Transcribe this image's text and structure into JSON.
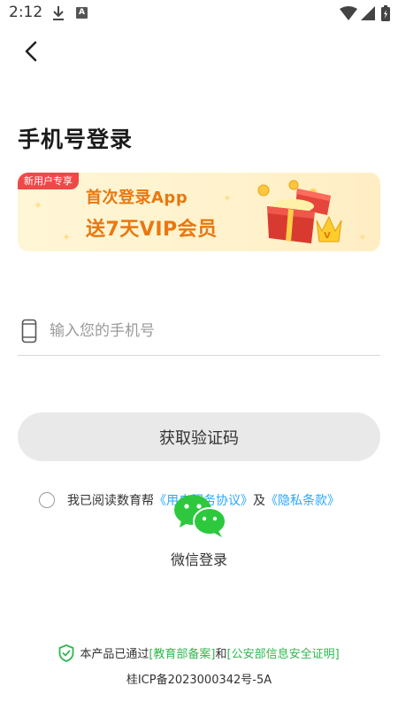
{
  "status_bar": {
    "time": "2:12",
    "icon_a": "A"
  },
  "title": "手机号登录",
  "promo": {
    "badge": "新用户专享",
    "line1": "首次登录App",
    "line2": "送7天VIP会员"
  },
  "phone": {
    "placeholder": "输入您的手机号",
    "value": ""
  },
  "get_code_button": "获取验证码",
  "agreement": {
    "prefix": "我已阅读数育帮",
    "service_link": "《用户服务协议》",
    "conjunction": "及",
    "privacy_link": "《隐私条款》",
    "checked": false
  },
  "wechat_login": "微信登录",
  "footer": {
    "prefix": "本产品已通过",
    "link1": "[教育部备案]",
    "mid": "和",
    "link2": "[公安部信息安全证明]",
    "icp": "桂ICP备2023000342号-5A"
  },
  "colors": {
    "accent_blue": "#29a6ff",
    "wechat_green": "#2dc83e",
    "promo_orange": "#e8780f",
    "badge_red": "#f04848"
  }
}
